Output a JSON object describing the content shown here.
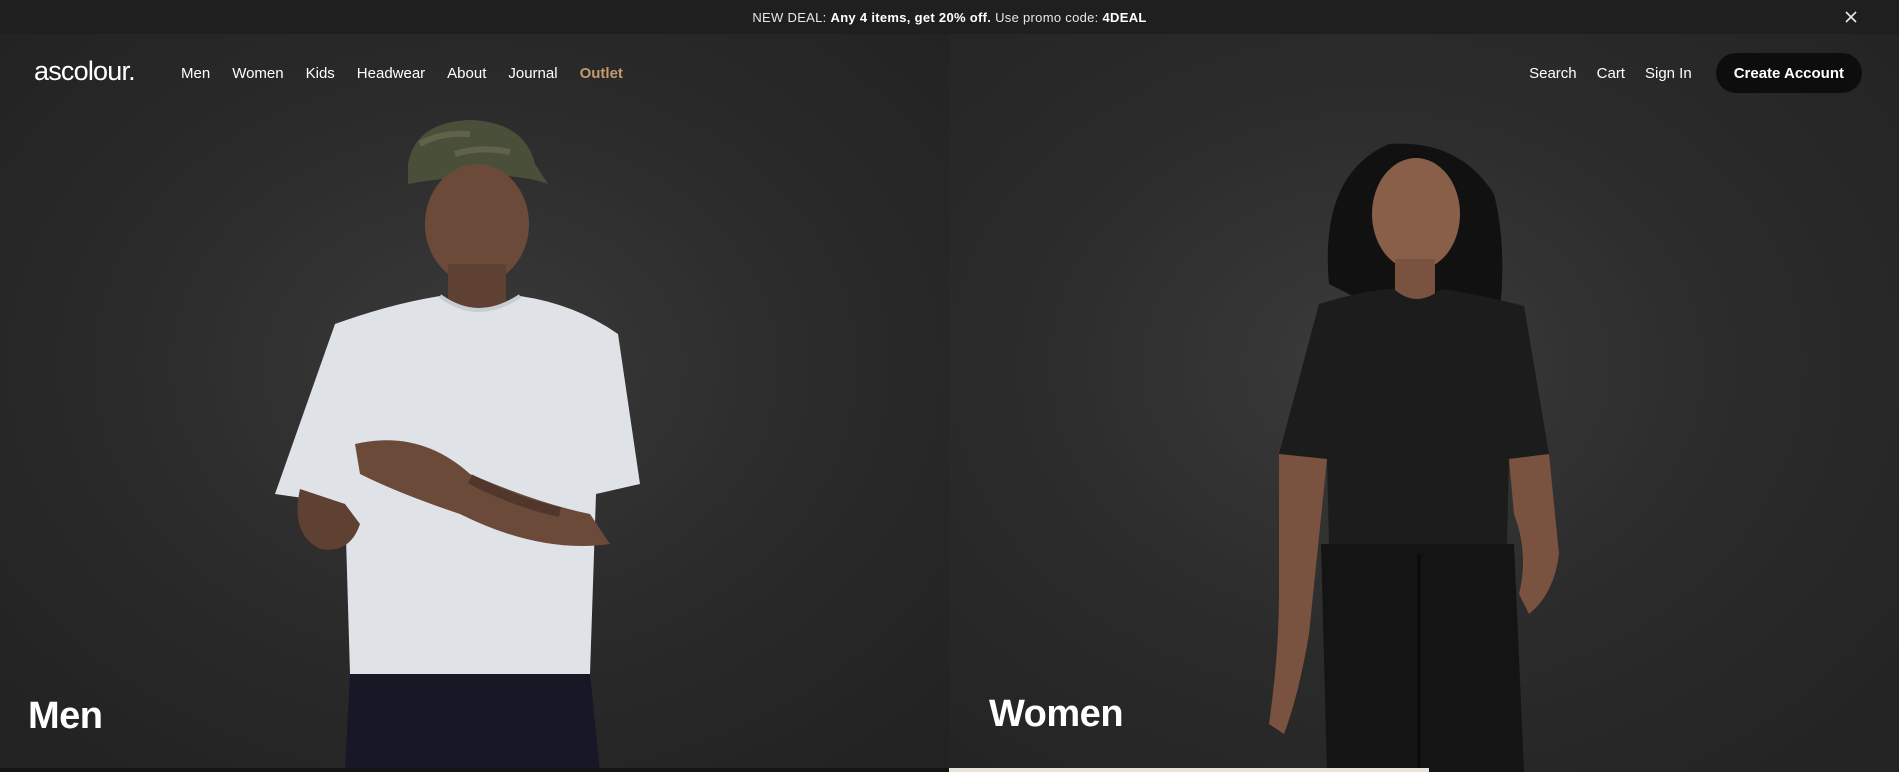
{
  "promo": {
    "prefix": "NEW DEAL: ",
    "highlight": "Any 4 items, get 20% off.",
    "middle": " Use promo code: ",
    "code": "4DEAL",
    "close_icon": "close-icon"
  },
  "nav": {
    "logo": "ascolour.",
    "links": [
      "Men",
      "Women",
      "Kids",
      "Headwear",
      "About",
      "Journal",
      "Outlet"
    ],
    "right": {
      "search": "Search",
      "cart": "Cart",
      "sign_in": "Sign In",
      "create_account": "Create Account"
    }
  },
  "hero": {
    "men_title": "Men",
    "women_title": "Women"
  },
  "colors": {
    "promo_bg": "#1f1f1f",
    "outlet_accent": "#c39a6b",
    "cta_bg": "#0d0d0d",
    "panel_bg": "#2a2a2a"
  }
}
